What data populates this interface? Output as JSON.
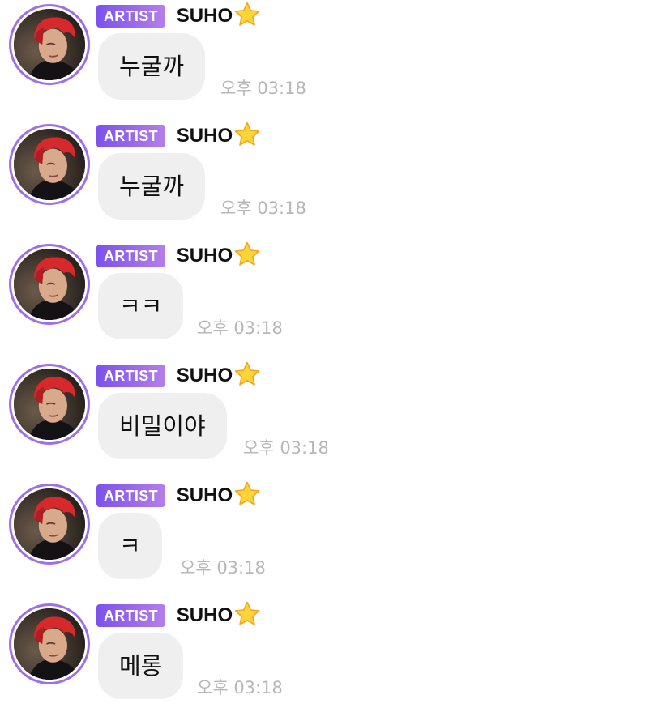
{
  "brand_colors": {
    "badge_gradient_start": "#7b52ec",
    "badge_gradient_end": "#b57ee9",
    "avatar_ring": "#a06ee8",
    "bubble_background": "#efefef",
    "timestamp_text": "#b7b7b7"
  },
  "messages": [
    {
      "avatar_icon": "profile-photo",
      "badge": "ARTIST",
      "sender": "SUHO",
      "sender_emoji_icon": "star-icon",
      "text": "누굴까",
      "time": "오후 03:18"
    },
    {
      "avatar_icon": "profile-photo",
      "badge": "ARTIST",
      "sender": "SUHO",
      "sender_emoji_icon": "star-icon",
      "text": "누굴까",
      "time": "오후 03:18"
    },
    {
      "avatar_icon": "profile-photo",
      "badge": "ARTIST",
      "sender": "SUHO",
      "sender_emoji_icon": "star-icon",
      "text": "ㅋㅋ",
      "time": "오후 03:18"
    },
    {
      "avatar_icon": "profile-photo",
      "badge": "ARTIST",
      "sender": "SUHO",
      "sender_emoji_icon": "star-icon",
      "text": "비밀이야",
      "time": "오후 03:18"
    },
    {
      "avatar_icon": "profile-photo",
      "badge": "ARTIST",
      "sender": "SUHO",
      "sender_emoji_icon": "star-icon",
      "text": "ㅋ",
      "time": "오후 03:18"
    },
    {
      "avatar_icon": "profile-photo",
      "badge": "ARTIST",
      "sender": "SUHO",
      "sender_emoji_icon": "star-icon",
      "text": "메롱",
      "time": "오후 03:18"
    }
  ]
}
